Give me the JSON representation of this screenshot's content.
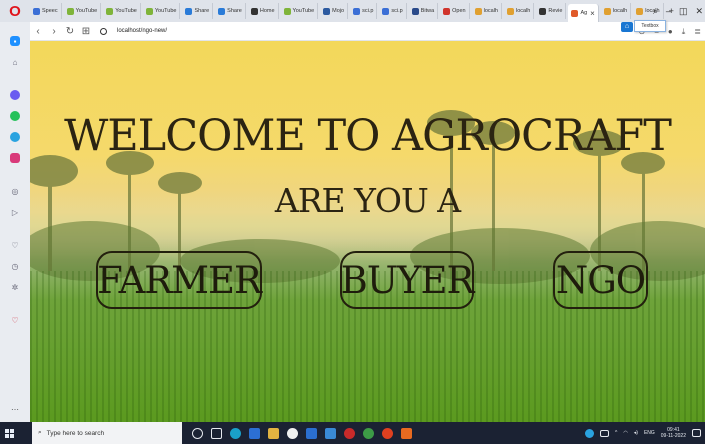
{
  "browser": {
    "tabs": [
      {
        "label": "Speec",
        "color": "#3b6fd6",
        "active": false
      },
      {
        "label": "YouTube",
        "color": "#7fb43a",
        "active": false
      },
      {
        "label": "YouTube",
        "color": "#7fb43a",
        "active": false
      },
      {
        "label": "YouTube",
        "color": "#7fb43a",
        "active": false
      },
      {
        "label": "Share",
        "color": "#2a7bd8",
        "active": false
      },
      {
        "label": "Share",
        "color": "#2a7bd8",
        "active": false
      },
      {
        "label": "Home",
        "color": "#333333",
        "active": false
      },
      {
        "label": "YouTube",
        "color": "#7fb43a",
        "active": false
      },
      {
        "label": "Mojo",
        "color": "#2c5aa0",
        "active": false
      },
      {
        "label": "sci.p",
        "color": "#3b6fd6",
        "active": false
      },
      {
        "label": "sci.p",
        "color": "#3b6fd6",
        "active": false
      },
      {
        "label": "Bitwa",
        "color": "#2a4a8a",
        "active": false
      },
      {
        "label": "Open",
        "color": "#d0342c",
        "active": false
      },
      {
        "label": "localh",
        "color": "#e0a030",
        "active": false
      },
      {
        "label": "localh",
        "color": "#e0a030",
        "active": false
      },
      {
        "label": "Revie",
        "color": "#333333",
        "active": false
      },
      {
        "label": "Ag",
        "color": "#e05a2a",
        "active": true
      },
      {
        "label": "localh",
        "color": "#e0a030",
        "active": false
      },
      {
        "label": "localh",
        "color": "#e0a030",
        "active": false
      }
    ],
    "new_tab": "+",
    "url": "localhost/ngo-new/",
    "tooltip": "Textbox"
  },
  "page": {
    "welcome": "WELCOME TO AGROCRAFT",
    "question": "ARE YOU A",
    "roles": {
      "farmer": "FARMER",
      "buyer": "BUYER",
      "ngo": "NGO"
    }
  },
  "taskbar": {
    "search_placeholder": "Type here to search",
    "language": "ENG",
    "time": "09:41",
    "date": "09-11-2022"
  },
  "colors": {
    "sky": "#f3d85a",
    "field": "#5b9a1f",
    "text": "#2b2412",
    "taskbar": "#1b2233"
  }
}
